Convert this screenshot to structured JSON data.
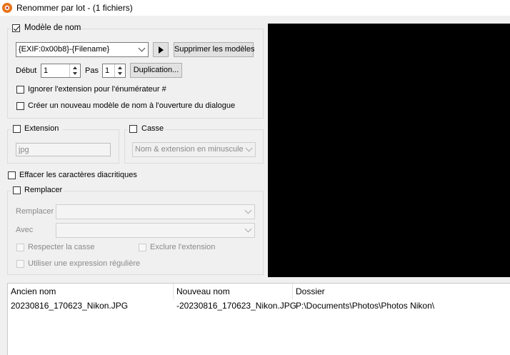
{
  "window": {
    "title": "Renommer par lot - (1 fichiers)"
  },
  "pattern": {
    "enabled_label": "Modèle de nom",
    "template_value": "{EXIF:0x00b8}-{Filename}",
    "delete_templates_label": "Supprimer les modèles",
    "start_label": "Début",
    "start_value": "1",
    "step_label": "Pas",
    "step_value": "1",
    "duplicate_label": "Duplication...",
    "ignore_ext_label": "Ignorer l'extension pour l'énumérateur #",
    "new_template_label": "Créer un nouveau modèle de nom à l'ouverture du dialogue"
  },
  "extension": {
    "label": "Extension",
    "value": "jpg"
  },
  "case": {
    "label": "Casse",
    "value": "Nom & extension en minuscule"
  },
  "diacritics": {
    "label": "Effacer les caractères diacritiques"
  },
  "replace": {
    "label": "Remplacer",
    "replace_label": "Remplacer",
    "with_label": "Avec",
    "match_case_label": "Respecter la casse",
    "exclude_ext_label": "Exclure l'extension",
    "regex_label": "Utiliser une expression régulière"
  },
  "file_list": {
    "columns": [
      "Ancien nom",
      "Nouveau nom",
      "Dossier"
    ],
    "rows": [
      [
        "20230816_170623_Nikon.JPG",
        "-20230816_170623_Nikon.JPG",
        "P:\\Documents\\Photos\\Photos Nikon\\"
      ]
    ]
  }
}
